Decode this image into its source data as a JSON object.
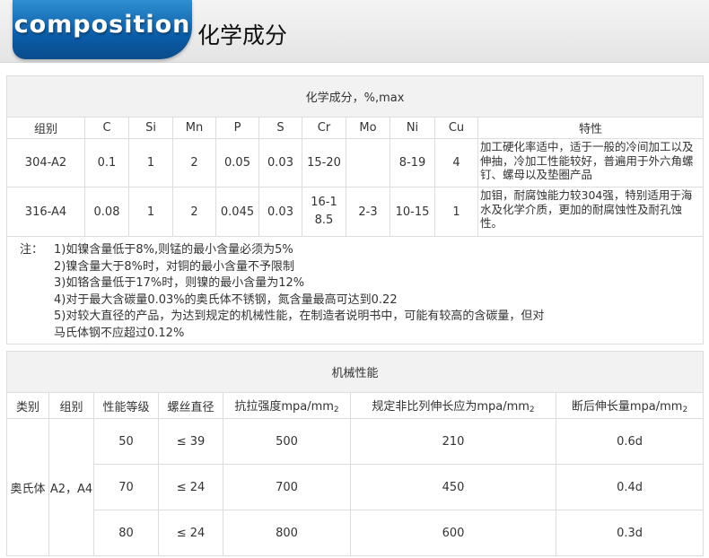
{
  "header": {
    "badge": "composition",
    "title": "化学成分"
  },
  "chem": {
    "caption": "化学成分，%,max",
    "headers": [
      "组别",
      "C",
      "Si",
      "Mn",
      "P",
      "S",
      "Cr",
      "Mo",
      "Ni",
      "Cu",
      "特性"
    ],
    "rows": [
      {
        "group": "304-A2",
        "c": "0.1",
        "si": "1",
        "mn": "2",
        "p": "0.05",
        "s": "0.03",
        "cr": "15-20",
        "mo": "",
        "ni": "8-19",
        "cu": "4",
        "trait": "加工硬化率适中，适于一般的冷间加工以及伸抽，冷加工性能较好，普遍用于外六角螺钉、螺母以及垫圈产品"
      },
      {
        "group": "316-A4",
        "c": "0.08",
        "si": "1",
        "mn": "2",
        "p": "0.045",
        "s": "0.03",
        "cr": "16-18.5",
        "mo": "2-3",
        "ni": "10-15",
        "cu": "1",
        "trait": "加钼，耐腐蚀能力较304强，特别适用于海水及化学介质，更加的耐腐蚀性及耐孔蚀性。"
      }
    ],
    "note_label": "注：",
    "notes": [
      "1)如镍含量低于8%,则锰的最小含量必须为5%",
      "2)镍含量大于8%时，对铜的最小含量不予限制",
      "3)如铬含量低于17%时，则镍的最小含量为12%",
      "4)对于最大含碳量0.03%的奥氏体不锈钢，氮含量最高可达到0.22",
      "5)对较大直径的产品，为达到规定的机械性能，在制造者说明书中，可能有较高的含碳量，但对",
      "马氏体钢不应超过0.12%"
    ]
  },
  "mech": {
    "caption": "机械性能",
    "headers": {
      "type": "类别",
      "group": "组别",
      "grade": "性能等级",
      "diameter": "螺丝直径",
      "tensile": "抗拉强度mpa/mm",
      "yield": "规定非比列伸长应为mpa/mm",
      "elongation": "断后伸长量mpa/mm",
      "unit_sub": "2"
    },
    "type_value": "奥氏体",
    "group_value": "A2，A4",
    "rows": [
      {
        "grade": "50",
        "diameter": "≤ 39",
        "tensile": "500",
        "yield": "210",
        "elongation": "0.6d"
      },
      {
        "grade": "70",
        "diameter": "≤ 24",
        "tensile": "700",
        "yield": "450",
        "elongation": "0.4d"
      },
      {
        "grade": "80",
        "diameter": "≤ 24",
        "tensile": "800",
        "yield": "600",
        "elongation": "0.3d"
      }
    ]
  }
}
